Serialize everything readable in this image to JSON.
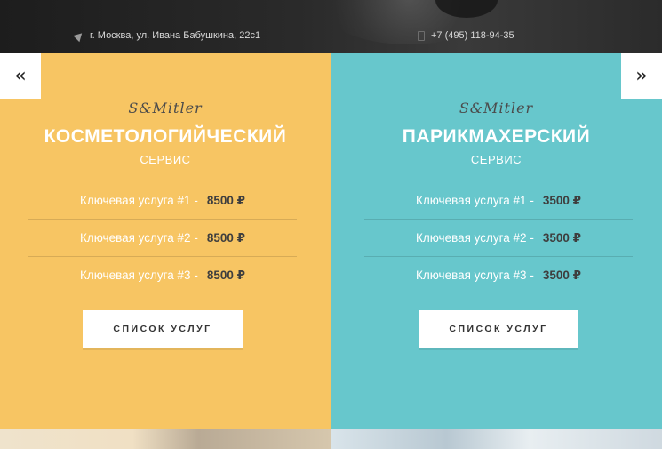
{
  "header": {
    "address": "г. Москва, ул. Ивана Бабушкина, 22с1",
    "phone": "+7 (495) 118-94-35",
    "address_icon": "location-arrow-icon",
    "phone_icon": "phone-icon"
  },
  "nav": {
    "prev": "«",
    "next": "»"
  },
  "panels": [
    {
      "brand": "S&Mitler",
      "title": "КОСМЕТОЛОГИЙЧЕСКИЙ",
      "subtitle": "СЕРВИС",
      "color": "#f7c563",
      "services": [
        {
          "label": "Ключевая услуга #1 -",
          "price": "8500 ₽"
        },
        {
          "label": "Ключевая услуга #2 -",
          "price": "8500 ₽"
        },
        {
          "label": "Ключевая услуга #3 -",
          "price": "8500 ₽"
        }
      ],
      "button": "СПИСОК УСЛУГ"
    },
    {
      "brand": "S&Mitler",
      "title": "ПАРИКМАХЕРСКИЙ",
      "subtitle": "СЕРВИС",
      "color": "#67c7cc",
      "services": [
        {
          "label": "Ключевая услуга #1 -",
          "price": "3500 ₽"
        },
        {
          "label": "Ключевая услуга #2 -",
          "price": "3500 ₽"
        },
        {
          "label": "Ключевая услуга #3 -",
          "price": "3500 ₽"
        }
      ],
      "button": "СПИСОК УСЛУГ"
    }
  ]
}
